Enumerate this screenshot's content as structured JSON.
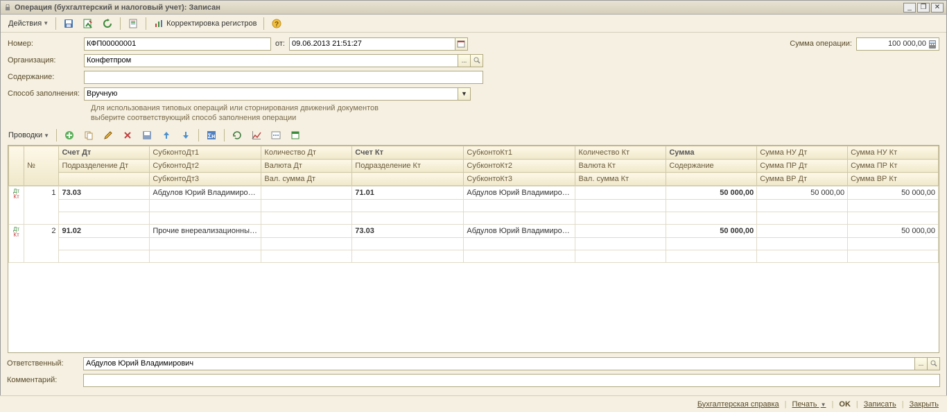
{
  "window": {
    "title": "Операция (бухгалтерский и налоговый учет): Записан"
  },
  "toolbar": {
    "actions": "Действия",
    "registers": "Корректировка регистров"
  },
  "form": {
    "number_label": "Номер:",
    "number": "КФП00000001",
    "from_label": "от:",
    "date": "09.06.2013 21:51:27",
    "org_label": "Организация:",
    "org": "Конфетпром",
    "content_label": "Содержание:",
    "content": "",
    "fill_label": "Способ заполнения:",
    "fill": "Вручную",
    "hint1": "Для использования типовых операций или сторнирования движений документов",
    "hint2": "выберите соответствующий способ заполнения операции",
    "sum_label": "Сумма операции:",
    "sum": "100 000,00"
  },
  "grid_toolbar": {
    "label": "Проводки"
  },
  "headers": {
    "num": "№",
    "acct_dt": "Счет Дт",
    "dept_dt": "Подразделение Дт",
    "sub_dt1": "СубконтоДт1",
    "sub_dt2": "СубконтоДт2",
    "sub_dt3": "СубконтоДт3",
    "qty_dt": "Количество Дт",
    "cur_dt": "Валюта Дт",
    "cursum_dt": "Вал. сумма Дт",
    "acct_kt": "Счет Кт",
    "dept_kt": "Подразделение Кт",
    "sub_kt1": "СубконтоКт1",
    "sub_kt2": "СубконтоКт2",
    "sub_kt3": "СубконтоКт3",
    "qty_kt": "Количество Кт",
    "cur_kt": "Валюта Кт",
    "cursum_kt": "Вал. сумма Кт",
    "sum": "Сумма",
    "desc": "Содержание",
    "nu_dt": "Сумма НУ Дт",
    "pr_dt": "Сумма ПР Дт",
    "vr_dt": "Сумма ВР Дт",
    "nu_kt": "Сумма НУ Кт",
    "pr_kt": "Сумма ПР Кт",
    "vr_kt": "Сумма ВР Кт"
  },
  "rows": [
    {
      "n": "1",
      "acct_dt": "73.03",
      "sub_dt1": "Абдулов Юрий Владимирович",
      "acct_kt": "71.01",
      "sub_kt1": "Абдулов Юрий Владимирович",
      "sum": "50 000,00",
      "nu_dt": "50 000,00",
      "nu_kt": "50 000,00"
    },
    {
      "n": "2",
      "acct_dt": "91.02",
      "sub_dt1": "Прочие внереализационные...",
      "acct_kt": "73.03",
      "sub_kt1": "Абдулов Юрий Владимирович",
      "sum": "50 000,00",
      "nu_dt": "",
      "nu_kt": "50 000,00"
    }
  ],
  "footer": {
    "resp_label": "Ответственный:",
    "resp": "Абдулов Юрий Владимирович",
    "comment_label": "Комментарий:",
    "comment": ""
  },
  "bottom": {
    "ref": "Бухгалтерская справка",
    "print": "Печать",
    "ok": "OK",
    "save": "Записать",
    "close": "Закрыть"
  }
}
